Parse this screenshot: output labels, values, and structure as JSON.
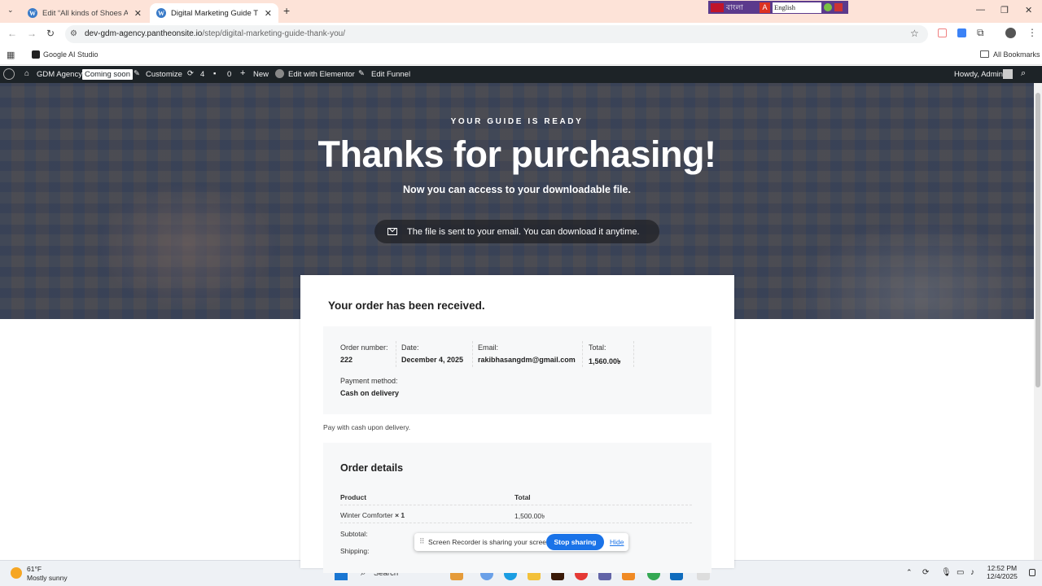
{
  "browser": {
    "tabs": [
      {
        "label": "Edit “All kinds of Shoes Availabl",
        "active": false
      },
      {
        "label": "Digital Marketing Guide Thank",
        "active": true
      }
    ],
    "url_host": "dev-gdm-agency.pantheonsite.io",
    "url_path": "/step/digital-marketing-guide-thank-you/",
    "bookmark": "Google AI Studio",
    "all_bookmarks": "All Bookmarks",
    "lang_widget": {
      "bangla": "বাংলা",
      "select": "English"
    }
  },
  "adminbar": {
    "site": "GDM Agency",
    "coming_soon": "Coming soon",
    "customize": "Customize",
    "updates": "4",
    "comments": "0",
    "new": "New",
    "elementor": "Edit with Elementor",
    "funnel": "Edit Funnel",
    "howdy": "Howdy, Admin"
  },
  "hero": {
    "kicker": "YOUR GUIDE IS READY",
    "headline": "Thanks for purchasing!",
    "subline": "Now you can access to your downloadable file.",
    "notice": "The file is sent to your email. You can download it anytime."
  },
  "order": {
    "received": "Your order has been received.",
    "number_label": "Order number:",
    "number": "222",
    "date_label": "Date:",
    "date": "December 4, 2025",
    "email_label": "Email:",
    "email": "rakibhasangdm@gmail.com",
    "total_label": "Total:",
    "total": "1,560.00৳",
    "payment_label": "Payment method:",
    "payment": "Cash on delivery",
    "pay_note": "Pay with cash upon delivery."
  },
  "details": {
    "title": "Order details",
    "col_product": "Product",
    "col_total": "Total",
    "item_name": "Winter Comforter",
    "item_qty": "× 1",
    "item_total": "1,500.00৳",
    "subtotal_label": "Subtotal:",
    "shipping_label": "Shipping:"
  },
  "share": {
    "text": "Screen Recorder is sharing your screen.",
    "stop": "Stop sharing",
    "hide": "Hide"
  },
  "taskbar": {
    "temp": "61°F",
    "weather": "Mostly sunny",
    "search": "Search",
    "time": "12:52 PM",
    "date": "12/4/2025"
  }
}
